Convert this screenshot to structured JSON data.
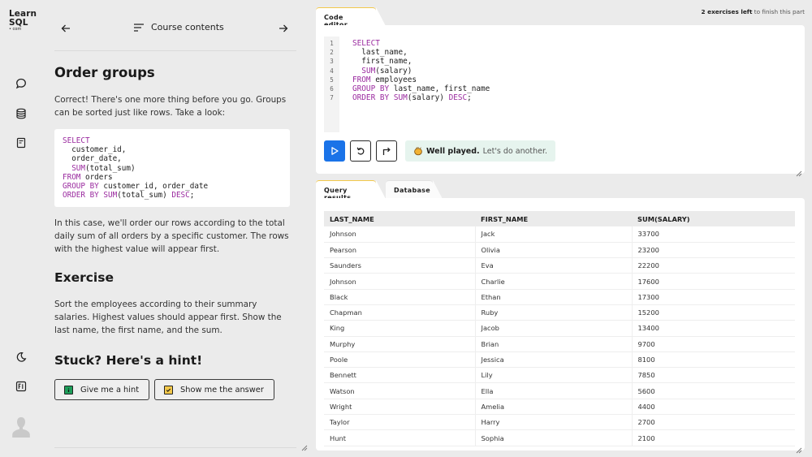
{
  "brand": {
    "line1": "Learn",
    "line2": "SQL",
    "line3": "• com"
  },
  "rail_icons": [
    "chat-icon",
    "database-icon",
    "cheat-sheet-icon",
    "dark-mode-icon",
    "fullscreen-icon",
    "user-avatar"
  ],
  "lesson_nav": {
    "course_contents_label": "Course contents"
  },
  "lesson": {
    "title": "Order groups",
    "intro": "Correct! There's one more thing before you go. Groups can be sorted just like rows. Take a look:",
    "example_code": [
      [
        {
          "t": "SELECT",
          "k": true
        }
      ],
      [
        {
          "t": "  customer_id,",
          "k": false
        }
      ],
      [
        {
          "t": "  order_date,",
          "k": false
        }
      ],
      [
        {
          "t": "  ",
          "k": false
        },
        {
          "t": "SUM",
          "k": true
        },
        {
          "t": "(total_sum)",
          "k": false
        }
      ],
      [
        {
          "t": "FROM",
          "k": true
        },
        {
          "t": " orders",
          "k": false
        }
      ],
      [
        {
          "t": "GROUP BY",
          "k": true
        },
        {
          "t": " customer_id, order_date",
          "k": false
        }
      ],
      [
        {
          "t": "ORDER BY",
          "k": true
        },
        {
          "t": " ",
          "k": false
        },
        {
          "t": "SUM",
          "k": true
        },
        {
          "t": "(total_sum) ",
          "k": false
        },
        {
          "t": "DESC",
          "k": true
        },
        {
          "t": ";",
          "k": false
        }
      ]
    ],
    "explanation": "In this case, we'll order our rows according to the total daily sum of all orders by a specific customer. The rows with the highest value will appear first.",
    "exercise_heading": "Exercise",
    "exercise_text": "Sort the employees according to their summary salaries. Highest values should appear first. Show the last name, the first name, and the sum.",
    "hint_heading": "Stuck? Here's a hint!",
    "hint_button": "Give me a hint",
    "answer_button": "Show me the answer"
  },
  "progress": {
    "bold": "2 exercises left",
    "rest": " to finish this part"
  },
  "editor": {
    "tab_label": "Code editor",
    "line_numbers": [
      "1",
      "2",
      "3",
      "4",
      "5",
      "6",
      "7"
    ],
    "code": [
      [
        {
          "t": "SELECT",
          "k": true
        }
      ],
      [
        {
          "t": "  last_name,",
          "k": false
        }
      ],
      [
        {
          "t": "  first_name,",
          "k": false
        }
      ],
      [
        {
          "t": "  ",
          "k": false
        },
        {
          "t": "SUM",
          "k": true
        },
        {
          "t": "(salary)",
          "k": false
        }
      ],
      [
        {
          "t": "FROM",
          "k": true
        },
        {
          "t": " employees",
          "k": false
        }
      ],
      [
        {
          "t": "GROUP BY",
          "k": true
        },
        {
          "t": " last_name, first_name",
          "k": false
        }
      ],
      [
        {
          "t": "ORDER BY",
          "k": true
        },
        {
          "t": " ",
          "k": false
        },
        {
          "t": "SUM",
          "k": true
        },
        {
          "t": "(salary) ",
          "k": false
        },
        {
          "t": "DESC",
          "k": true
        },
        {
          "t": ";",
          "k": false
        }
      ]
    ],
    "feedback_bold": "Well played.",
    "feedback_rest": "Let's do another.",
    "run_color": "#1a73e8"
  },
  "results": {
    "tabs": [
      {
        "label": "Query results",
        "active": true
      },
      {
        "label": "Database",
        "active": false
      }
    ],
    "columns": [
      "LAST_NAME",
      "FIRST_NAME",
      "SUM(SALARY)"
    ],
    "rows": [
      [
        "Johnson",
        "Jack",
        "33700"
      ],
      [
        "Pearson",
        "Olivia",
        "23200"
      ],
      [
        "Saunders",
        "Eva",
        "22200"
      ],
      [
        "Johnson",
        "Charlie",
        "17600"
      ],
      [
        "Black",
        "Ethan",
        "17300"
      ],
      [
        "Chapman",
        "Ruby",
        "15200"
      ],
      [
        "King",
        "Jacob",
        "13400"
      ],
      [
        "Murphy",
        "Brian",
        "9700"
      ],
      [
        "Poole",
        "Jessica",
        "8100"
      ],
      [
        "Bennett",
        "Lily",
        "7850"
      ],
      [
        "Watson",
        "Ella",
        "5600"
      ],
      [
        "Wright",
        "Amelia",
        "4400"
      ],
      [
        "Taylor",
        "Harry",
        "2700"
      ],
      [
        "Hunt",
        "Sophia",
        "2100"
      ]
    ]
  }
}
